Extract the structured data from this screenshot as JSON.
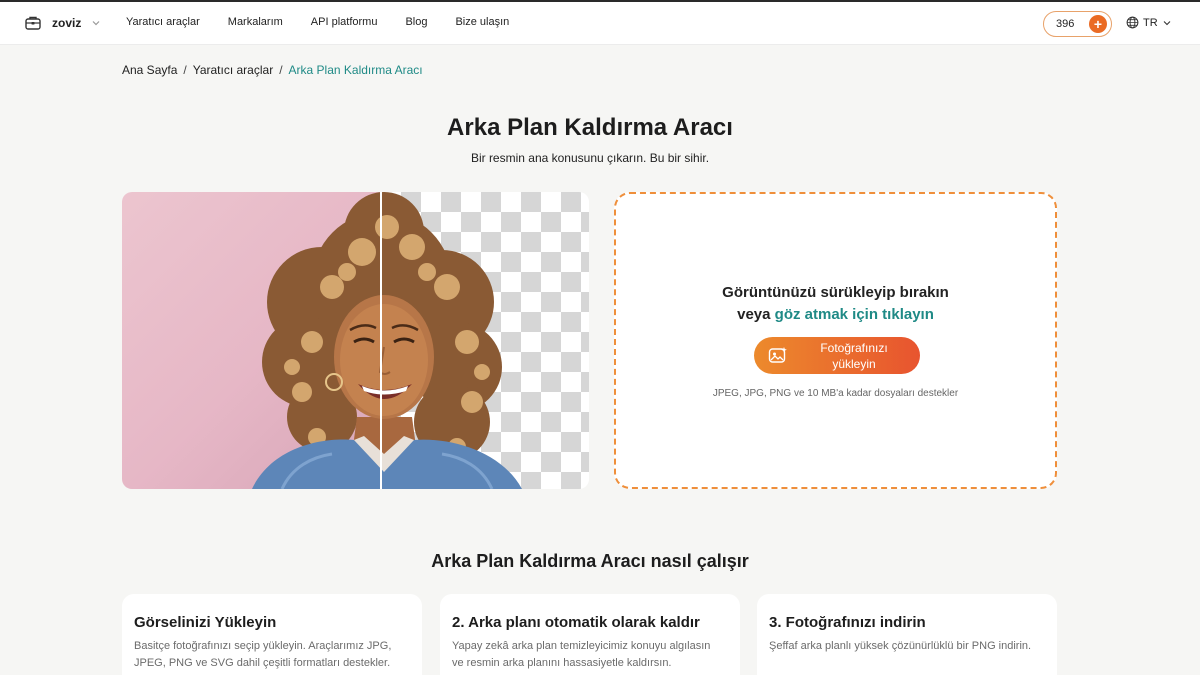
{
  "header": {
    "brand_name": "zoviz",
    "nav": [
      "Yaratıcı araçlar",
      "Markalarım",
      "API platformu",
      "Blog",
      "Bize ulaşın"
    ],
    "credits": "396",
    "language": "TR"
  },
  "breadcrumb": {
    "home": "Ana Sayfa",
    "section": "Yaratıcı araçlar",
    "current": "Arka Plan Kaldırma Aracı",
    "separator": "/"
  },
  "hero": {
    "title": "Arka Plan Kaldırma Aracı",
    "subtitle": "Bir resmin ana konusunu çıkarın. Bu bir sihir."
  },
  "upload": {
    "line1": "Görüntünüzü sürükleyip bırakın",
    "line2_prefix": "veya",
    "line2_link": "göz atmak için tıklayın",
    "button_label": "Fotoğrafınızı yükleyin",
    "note": "JPEG, JPG, PNG ve 10 MB'a kadar dosyaları destekler"
  },
  "how_it_works": {
    "title": "Arka Plan Kaldırma Aracı nasıl çalışır",
    "steps": [
      {
        "title": "Görselinizi Yükleyin",
        "text": "Basitçe fotoğrafınızı seçip yükleyin. Araçlarımız JPG, JPEG, PNG ve SVG dahil çeşitli formatları destekler."
      },
      {
        "title": "2. Arka planı otomatik olarak kaldır",
        "text": "Yapay zekâ arka plan temizleyicimiz konuyu algılasın ve resmin arka planını hassasiyetle kaldırsın."
      },
      {
        "title": "3. Fotoğrafınızı indirin",
        "text": "Şeffaf arka planlı yüksek çözünürlüklü bir PNG indirin."
      }
    ]
  },
  "colors": {
    "accent_teal": "#1f8a86",
    "accent_orange": "#ea6b24"
  },
  "icons": {
    "brand": "toolbox-icon",
    "language": "globe-icon",
    "upload_button": "image-sparkle-icon"
  }
}
